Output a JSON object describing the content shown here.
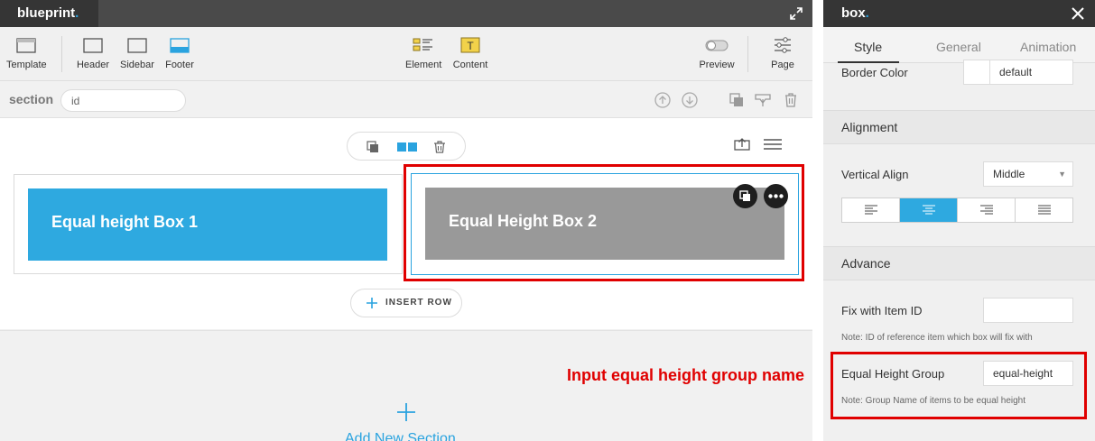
{
  "app": {
    "brand": "blueprint",
    "brand_dot": "."
  },
  "toolbar": {
    "template": "Template",
    "header": "Header",
    "sidebar": "Sidebar",
    "footer": "Footer",
    "element": "Element",
    "content": "Content",
    "preview": "Preview",
    "page": "Page"
  },
  "section_bar": {
    "label": "section",
    "id_value": "id"
  },
  "canvas": {
    "box1_text": "Equal height Box 1",
    "box2_text": "Equal Height Box 2",
    "insert_row": "INSERT ROW"
  },
  "annotation": {
    "text": "Input equal height group name"
  },
  "add_section": {
    "label": "Add New Section"
  },
  "panel": {
    "title": "box",
    "title_dot": ".",
    "tabs": [
      "Style",
      "General",
      "Animation"
    ],
    "border_color": {
      "label": "Border Color",
      "value": "default"
    },
    "alignment": {
      "heading": "Alignment",
      "vertical_align_label": "Vertical Align",
      "vertical_align_value": "Middle",
      "text_align_selected": "center"
    },
    "advance": {
      "heading": "Advance",
      "fix_label": "Fix with Item ID",
      "fix_value": "",
      "fix_note": "Note: ID of reference item which box will fix with",
      "eq_label": "Equal Height Group",
      "eq_value": "equal-height",
      "eq_note": "Note: Group Name of items to be equal height"
    }
  },
  "colors": {
    "accent": "#2ea9e0",
    "highlight": "#e00000",
    "box2": "#999999",
    "dark": "#353535"
  }
}
